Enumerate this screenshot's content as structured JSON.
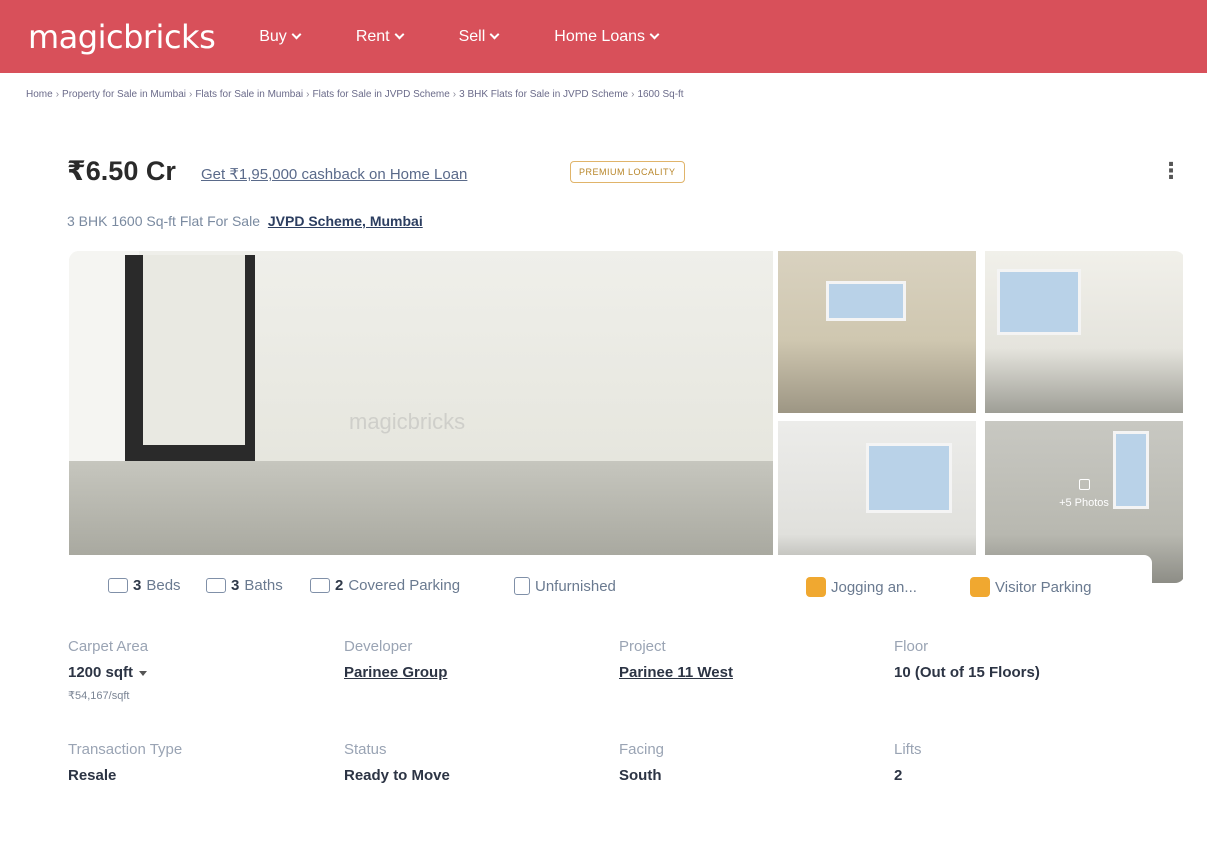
{
  "header": {
    "logo": "magicbricks",
    "nav": [
      {
        "label": "Buy"
      },
      {
        "label": "Rent"
      },
      {
        "label": "Sell"
      },
      {
        "label": "Home Loans"
      }
    ]
  },
  "breadcrumb": [
    "Home",
    "Property for Sale in Mumbai",
    "Flats for Sale in Mumbai",
    "Flats for Sale in JVPD Scheme",
    "3 BHK Flats for Sale in JVPD Scheme",
    "1600 Sq-ft"
  ],
  "listing": {
    "price": "₹6.50 Cr",
    "cashback": "Get ₹1,95,000 cashback on Home Loan",
    "badge": "PREMIUM LOCALITY",
    "menu": "⋮",
    "subtitle": "3 BHK 1600 Sq-ft Flat For Sale",
    "location": "JVPD Scheme, Mumbai"
  },
  "gallery": {
    "watermark": "magicbricks",
    "more_photos": "+5 Photos"
  },
  "features": {
    "beds_count": "3",
    "beds_label": "Beds",
    "baths_count": "3",
    "baths_label": "Baths",
    "parking_count": "2",
    "parking_label": "Covered Parking",
    "furnishing": "Unfurnished",
    "amenity1": "Jogging an...",
    "amenity2": "Visitor Parking"
  },
  "details": {
    "carpet_area_label": "Carpet Area",
    "carpet_area_value": "1200 sqft",
    "price_per_sqft": "₹54,167/sqft",
    "developer_label": "Developer",
    "developer_value": "Parinee Group",
    "project_label": "Project",
    "project_value": "Parinee 11 West",
    "floor_label": "Floor",
    "floor_value": "10 (Out of 15 Floors)",
    "transaction_label": "Transaction Type",
    "transaction_value": "Resale",
    "status_label": "Status",
    "status_value": "Ready to Move",
    "facing_label": "Facing",
    "facing_value": "South",
    "lifts_label": "Lifts",
    "lifts_value": "2"
  }
}
